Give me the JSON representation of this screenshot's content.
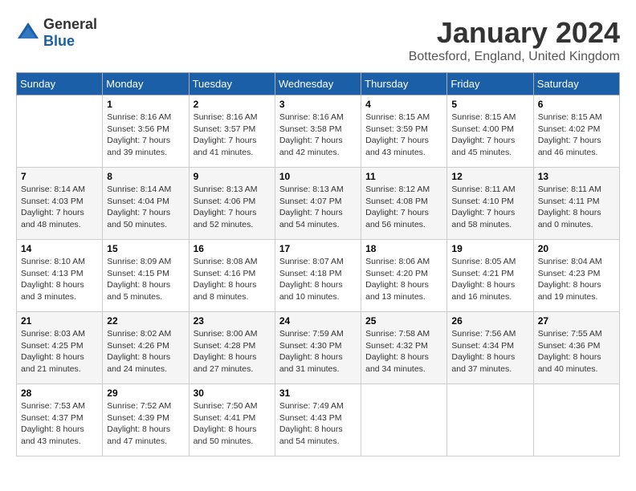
{
  "logo": {
    "general": "General",
    "blue": "Blue"
  },
  "title": "January 2024",
  "location": "Bottesford, England, United Kingdom",
  "days_of_week": [
    "Sunday",
    "Monday",
    "Tuesday",
    "Wednesday",
    "Thursday",
    "Friday",
    "Saturday"
  ],
  "weeks": [
    [
      {
        "day": "",
        "sunrise": "",
        "sunset": "",
        "daylight": ""
      },
      {
        "day": "1",
        "sunrise": "Sunrise: 8:16 AM",
        "sunset": "Sunset: 3:56 PM",
        "daylight": "Daylight: 7 hours and 39 minutes."
      },
      {
        "day": "2",
        "sunrise": "Sunrise: 8:16 AM",
        "sunset": "Sunset: 3:57 PM",
        "daylight": "Daylight: 7 hours and 41 minutes."
      },
      {
        "day": "3",
        "sunrise": "Sunrise: 8:16 AM",
        "sunset": "Sunset: 3:58 PM",
        "daylight": "Daylight: 7 hours and 42 minutes."
      },
      {
        "day": "4",
        "sunrise": "Sunrise: 8:15 AM",
        "sunset": "Sunset: 3:59 PM",
        "daylight": "Daylight: 7 hours and 43 minutes."
      },
      {
        "day": "5",
        "sunrise": "Sunrise: 8:15 AM",
        "sunset": "Sunset: 4:00 PM",
        "daylight": "Daylight: 7 hours and 45 minutes."
      },
      {
        "day": "6",
        "sunrise": "Sunrise: 8:15 AM",
        "sunset": "Sunset: 4:02 PM",
        "daylight": "Daylight: 7 hours and 46 minutes."
      }
    ],
    [
      {
        "day": "7",
        "sunrise": "Sunrise: 8:14 AM",
        "sunset": "Sunset: 4:03 PM",
        "daylight": "Daylight: 7 hours and 48 minutes."
      },
      {
        "day": "8",
        "sunrise": "Sunrise: 8:14 AM",
        "sunset": "Sunset: 4:04 PM",
        "daylight": "Daylight: 7 hours and 50 minutes."
      },
      {
        "day": "9",
        "sunrise": "Sunrise: 8:13 AM",
        "sunset": "Sunset: 4:06 PM",
        "daylight": "Daylight: 7 hours and 52 minutes."
      },
      {
        "day": "10",
        "sunrise": "Sunrise: 8:13 AM",
        "sunset": "Sunset: 4:07 PM",
        "daylight": "Daylight: 7 hours and 54 minutes."
      },
      {
        "day": "11",
        "sunrise": "Sunrise: 8:12 AM",
        "sunset": "Sunset: 4:08 PM",
        "daylight": "Daylight: 7 hours and 56 minutes."
      },
      {
        "day": "12",
        "sunrise": "Sunrise: 8:11 AM",
        "sunset": "Sunset: 4:10 PM",
        "daylight": "Daylight: 7 hours and 58 minutes."
      },
      {
        "day": "13",
        "sunrise": "Sunrise: 8:11 AM",
        "sunset": "Sunset: 4:11 PM",
        "daylight": "Daylight: 8 hours and 0 minutes."
      }
    ],
    [
      {
        "day": "14",
        "sunrise": "Sunrise: 8:10 AM",
        "sunset": "Sunset: 4:13 PM",
        "daylight": "Daylight: 8 hours and 3 minutes."
      },
      {
        "day": "15",
        "sunrise": "Sunrise: 8:09 AM",
        "sunset": "Sunset: 4:15 PM",
        "daylight": "Daylight: 8 hours and 5 minutes."
      },
      {
        "day": "16",
        "sunrise": "Sunrise: 8:08 AM",
        "sunset": "Sunset: 4:16 PM",
        "daylight": "Daylight: 8 hours and 8 minutes."
      },
      {
        "day": "17",
        "sunrise": "Sunrise: 8:07 AM",
        "sunset": "Sunset: 4:18 PM",
        "daylight": "Daylight: 8 hours and 10 minutes."
      },
      {
        "day": "18",
        "sunrise": "Sunrise: 8:06 AM",
        "sunset": "Sunset: 4:20 PM",
        "daylight": "Daylight: 8 hours and 13 minutes."
      },
      {
        "day": "19",
        "sunrise": "Sunrise: 8:05 AM",
        "sunset": "Sunset: 4:21 PM",
        "daylight": "Daylight: 8 hours and 16 minutes."
      },
      {
        "day": "20",
        "sunrise": "Sunrise: 8:04 AM",
        "sunset": "Sunset: 4:23 PM",
        "daylight": "Daylight: 8 hours and 19 minutes."
      }
    ],
    [
      {
        "day": "21",
        "sunrise": "Sunrise: 8:03 AM",
        "sunset": "Sunset: 4:25 PM",
        "daylight": "Daylight: 8 hours and 21 minutes."
      },
      {
        "day": "22",
        "sunrise": "Sunrise: 8:02 AM",
        "sunset": "Sunset: 4:26 PM",
        "daylight": "Daylight: 8 hours and 24 minutes."
      },
      {
        "day": "23",
        "sunrise": "Sunrise: 8:00 AM",
        "sunset": "Sunset: 4:28 PM",
        "daylight": "Daylight: 8 hours and 27 minutes."
      },
      {
        "day": "24",
        "sunrise": "Sunrise: 7:59 AM",
        "sunset": "Sunset: 4:30 PM",
        "daylight": "Daylight: 8 hours and 31 minutes."
      },
      {
        "day": "25",
        "sunrise": "Sunrise: 7:58 AM",
        "sunset": "Sunset: 4:32 PM",
        "daylight": "Daylight: 8 hours and 34 minutes."
      },
      {
        "day": "26",
        "sunrise": "Sunrise: 7:56 AM",
        "sunset": "Sunset: 4:34 PM",
        "daylight": "Daylight: 8 hours and 37 minutes."
      },
      {
        "day": "27",
        "sunrise": "Sunrise: 7:55 AM",
        "sunset": "Sunset: 4:36 PM",
        "daylight": "Daylight: 8 hours and 40 minutes."
      }
    ],
    [
      {
        "day": "28",
        "sunrise": "Sunrise: 7:53 AM",
        "sunset": "Sunset: 4:37 PM",
        "daylight": "Daylight: 8 hours and 43 minutes."
      },
      {
        "day": "29",
        "sunrise": "Sunrise: 7:52 AM",
        "sunset": "Sunset: 4:39 PM",
        "daylight": "Daylight: 8 hours and 47 minutes."
      },
      {
        "day": "30",
        "sunrise": "Sunrise: 7:50 AM",
        "sunset": "Sunset: 4:41 PM",
        "daylight": "Daylight: 8 hours and 50 minutes."
      },
      {
        "day": "31",
        "sunrise": "Sunrise: 7:49 AM",
        "sunset": "Sunset: 4:43 PM",
        "daylight": "Daylight: 8 hours and 54 minutes."
      },
      {
        "day": "",
        "sunrise": "",
        "sunset": "",
        "daylight": ""
      },
      {
        "day": "",
        "sunrise": "",
        "sunset": "",
        "daylight": ""
      },
      {
        "day": "",
        "sunrise": "",
        "sunset": "",
        "daylight": ""
      }
    ]
  ]
}
